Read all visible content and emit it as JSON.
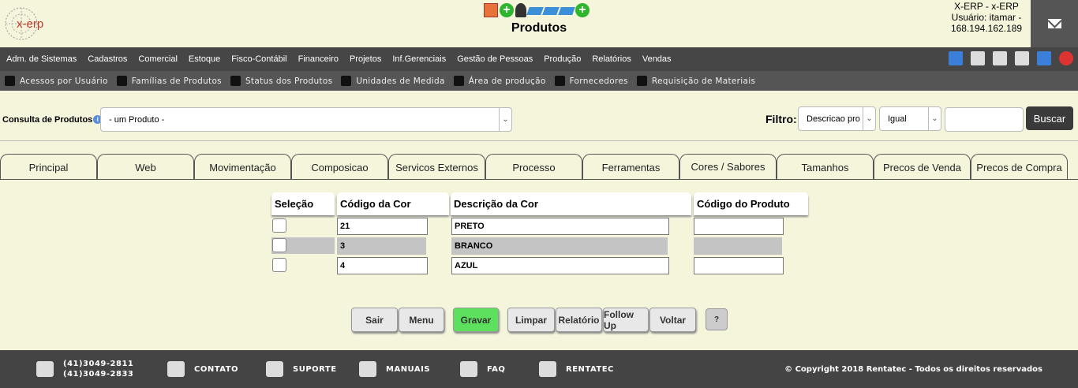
{
  "header": {
    "page_title": "Produtos",
    "user_line1": "X-ERP - x-ERP",
    "user_line2": "Usuário: itamar -",
    "user_line3": "168.194.162.189",
    "logo_text": "x-erp"
  },
  "main_menu": [
    "Adm. de Sistemas",
    "Cadastros",
    "Comercial",
    "Estoque",
    "Fisco-Contábil",
    "Financeiro",
    "Projetos",
    "Inf.Gerenciais",
    "Gestão de Pessoas",
    "Produção",
    "Relatórios",
    "Vendas"
  ],
  "sub_menu": [
    "Acessos por Usuário",
    "Famílias de Produtos",
    "Status dos Produtos",
    "Unidades de Medida",
    "Área de produção",
    "Fornecedores",
    "Requisição de Materiais"
  ],
  "search": {
    "consulta_label": "Consulta de Produtos",
    "produto_select": "- um Produto -",
    "filtro_label": "Filtro:",
    "filtro_campo": "Descricao pro",
    "filtro_operador": "Igual",
    "filtro_valor": "",
    "buscar_label": "Buscar"
  },
  "tabs": [
    "Principal",
    "Web",
    "Movimentação",
    "Composicao",
    "Servicos Externos",
    "Processo",
    "Ferramentas",
    "Cores / Sabores",
    "Tamanhos",
    "Precos de Venda",
    "Precos de Compra"
  ],
  "active_tab": "Cores / Sabores",
  "grid": {
    "headers": [
      "Seleção",
      "Código da Cor",
      "Descrição da Cor",
      "Código do Produto"
    ],
    "rows": [
      {
        "codigo": "21",
        "descricao": "PRETO",
        "produto": ""
      },
      {
        "codigo": "3",
        "descricao": "BRANCO",
        "produto": ""
      },
      {
        "codigo": "4",
        "descricao": "AZUL",
        "produto": ""
      }
    ]
  },
  "buttons": {
    "sair": "Sair",
    "menu": "Menu",
    "gravar": "Gravar",
    "limpar": "Limpar",
    "relatorio": "Relatório",
    "followup": "Follow Up",
    "voltar": "Voltar",
    "help": "?"
  },
  "footer": {
    "phone1": "(41)3049-2811",
    "phone2": "(41)3049-2833",
    "contato": "CONTATO",
    "suporte": "SUPORTE",
    "manuais": "MANUAIS",
    "faq": "FAQ",
    "rentatec": "RENTATEC",
    "copyright": "© Copyright 2018 Rentatec - Todos os direitos reservados"
  },
  "colors": {
    "background": "#f5f5dc",
    "menu_bar": "#464646",
    "sub_menu_bar": "#555555",
    "gravar_button": "#5de05d",
    "footer": "#444444"
  }
}
